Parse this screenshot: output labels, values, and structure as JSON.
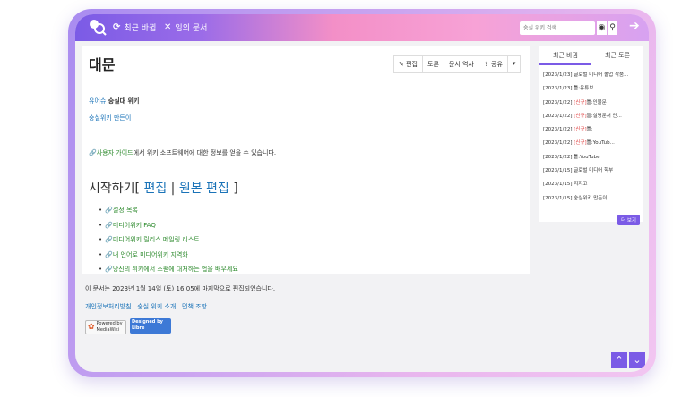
{
  "topbar": {
    "nav": [
      {
        "icon": "refresh-icon",
        "glyph": "⟳",
        "label": "최근 바뀜"
      },
      {
        "icon": "shuffle-icon",
        "glyph": "✕",
        "label": "임의 문서"
      }
    ],
    "search_placeholder": "숭실 위키 검색"
  },
  "article": {
    "title": "대문",
    "actions": [
      "편집",
      "토론",
      "문서 역사",
      "공유",
      "▾"
    ],
    "intro_link": "유어슈",
    "intro_bold": " 숭실대 위키",
    "maker_link": "숭실위키 만든이",
    "guide_link": "사용자 가이드",
    "guide_text": "에서 위키 소프트웨어에 대한 정보를 얻을 수 있습니다.",
    "heading": "시작하기",
    "heading_edit": "편집",
    "heading_source": "원본 편집",
    "links": [
      "설정 목록",
      "미디어위키 FAQ",
      "미디어위키 릴리스 메일링 리스트",
      "내 언어로 미디어위키 지역화",
      "당신의 위키에서 스팸에 대처하는 법을 배우세요"
    ]
  },
  "footer": {
    "last_edit": "이 문서는 2023년 1월 14일 (토) 16:05에 마지막으로 편집되었습니다.",
    "links": [
      "개인정보처리방침",
      "숭실 위키 소개",
      "면책 조항"
    ],
    "badge_mw": "Powered by MediaWiki",
    "badge_libre": "Designed by Libre"
  },
  "sidebar": {
    "tabs": [
      "최근 바뀜",
      "최근 토론"
    ],
    "recent": [
      {
        "date": "[2023/1/23]",
        "new": "",
        "text": "글로벌 미디어 졸업 작품..."
      },
      {
        "date": "[2023/1/23]",
        "new": "",
        "text": "틀:유튜브"
      },
      {
        "date": "[2023/1/22]",
        "new": "[신규]",
        "text": "틀:인물문"
      },
      {
        "date": "[2023/1/22]",
        "new": "[신규]",
        "text": "틀:설명문서 안..."
      },
      {
        "date": "[2023/1/22]",
        "new": "[신규]",
        "text": "틀:"
      },
      {
        "date": "[2023/1/22]",
        "new": "[신규]",
        "text": "틀:YouTub..."
      },
      {
        "date": "[2023/1/22]",
        "new": "",
        "text": "틀:YouTube"
      },
      {
        "date": "[2023/1/15]",
        "new": "",
        "text": "글로벌 미디어 학부"
      },
      {
        "date": "[2023/1/15]",
        "new": "",
        "text": "지지고"
      },
      {
        "date": "[2023/1/15]",
        "new": "",
        "text": "숭실위키 만든이"
      }
    ],
    "more": "더 보기"
  },
  "colors": {
    "accent": "#7b5be6",
    "link": "#1a73b8",
    "green_link": "#2d8a2d",
    "new": "#e04040"
  }
}
